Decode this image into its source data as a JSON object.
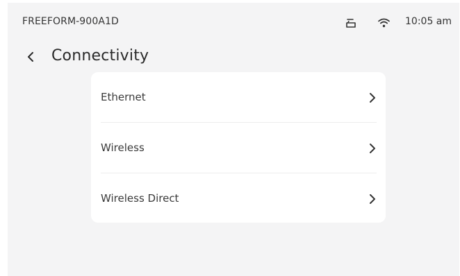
{
  "status_bar": {
    "device_name": "FREEFORM-900A1D",
    "time": "10:05 am",
    "icons": [
      "tray-icon",
      "wifi-icon"
    ]
  },
  "header": {
    "back_icon": "chevron-left-icon",
    "title": "Connectivity"
  },
  "menu": {
    "items": [
      {
        "label": "Ethernet",
        "icon": "chevron-right-icon"
      },
      {
        "label": "Wireless",
        "icon": "chevron-right-icon"
      },
      {
        "label": "Wireless Direct",
        "icon": "chevron-right-icon"
      }
    ]
  },
  "colors": {
    "background": "#f4f4f5",
    "card": "#ffffff",
    "text": "#2b2b2b",
    "divider": "#ececec"
  }
}
